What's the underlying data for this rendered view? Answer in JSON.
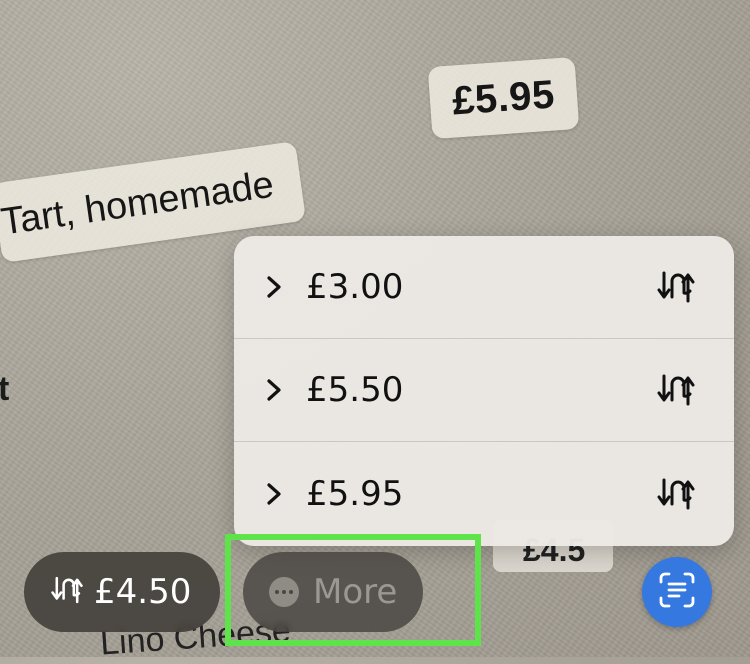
{
  "scanned_text": {
    "price_595": "£5.95",
    "tart_line": "Tart, homemade",
    "stray_char": "t",
    "bottom_line": "Lino Cheese",
    "hidden_chip": "£4.5"
  },
  "price_menu": {
    "items": [
      {
        "label": "£3.00",
        "icon": "currency-convert-icon"
      },
      {
        "label": "£5.50",
        "icon": "currency-convert-icon"
      },
      {
        "label": "£5.95",
        "icon": "currency-convert-icon"
      }
    ]
  },
  "bottom_bar": {
    "currency_button": {
      "label": "£4.50",
      "icon": "currency-convert-icon"
    },
    "more_button": {
      "label": "More",
      "icon": "ellipsis-circle-icon"
    },
    "live_text_button": {
      "icon": "live-text-icon"
    }
  },
  "colors": {
    "accent_blue": "#3478e0",
    "highlight_green": "#5fe34a"
  }
}
